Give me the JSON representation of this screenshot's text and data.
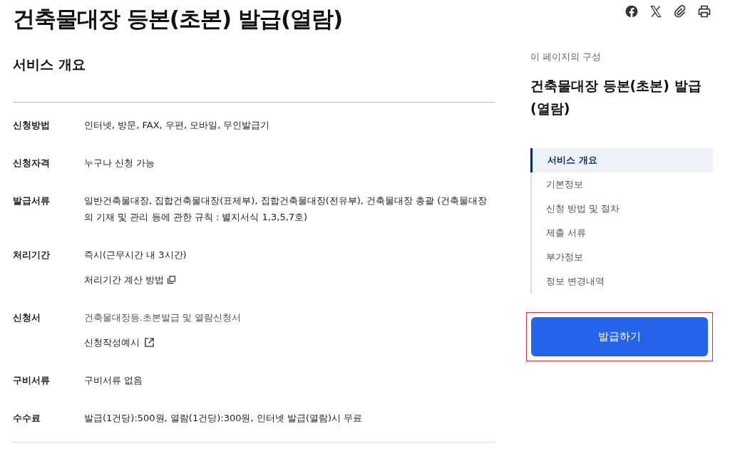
{
  "title": "건축물대장 등본(초본) 발급(열람)",
  "share_icons": [
    {
      "kind": "facebook"
    },
    {
      "kind": "x"
    },
    {
      "kind": "link"
    },
    {
      "kind": "print"
    }
  ],
  "section_title": "서비스 개요",
  "rows": [
    {
      "label": "신청방법",
      "values": [
        {
          "kind": "text",
          "text": "인터넷, 방문, FAX, 우편, 모바일, 무인발급기"
        }
      ]
    },
    {
      "label": "신청자격",
      "values": [
        {
          "kind": "text",
          "text": "누구나 신청 가능"
        }
      ]
    },
    {
      "label": "발급서류",
      "values": [
        {
          "kind": "text",
          "text": "일반건축물대장, 집합건축물대장(표제부), 집합건축물대장(전유부), 건축물대장 총괄 (건축물대장의 기재 및 관리 등에 관한 규칙 : 별지서식 1,3,5,7호)"
        }
      ]
    },
    {
      "label": "처리기간",
      "values": [
        {
          "kind": "text",
          "text": "즉시(근무시간 내 3시간)"
        },
        {
          "kind": "popup-link",
          "text": "처리기간 계산 방법"
        }
      ]
    },
    {
      "label": "신청서",
      "values": [
        {
          "kind": "muted",
          "text": "건축물대장등.초본발급 및 열람신청서"
        },
        {
          "kind": "external-link",
          "text": "신청작성예시"
        }
      ]
    },
    {
      "label": "구비서류",
      "values": [
        {
          "kind": "text",
          "text": "구비서류 없음"
        }
      ]
    },
    {
      "label": "수수료",
      "values": [
        {
          "kind": "text",
          "text": "발급(1건당):500원, 열람(1건당):300원, 인터넷 발급(열람)시 무료"
        }
      ]
    }
  ],
  "toc": {
    "caption": "이 페이지의 구성",
    "title": "건축물대장 등본(초본) 발급(열람)",
    "items": [
      {
        "label": "서비스 개요",
        "selected": true
      },
      {
        "label": "기본정보",
        "selected": false
      },
      {
        "label": "신청 방법 및 절차",
        "selected": false
      },
      {
        "label": "제출 서류",
        "selected": false
      },
      {
        "label": "부가정보",
        "selected": false
      },
      {
        "label": "정보 변경내역",
        "selected": false
      }
    ]
  },
  "action_button": {
    "label": "발급하기",
    "highlighted": true
  }
}
